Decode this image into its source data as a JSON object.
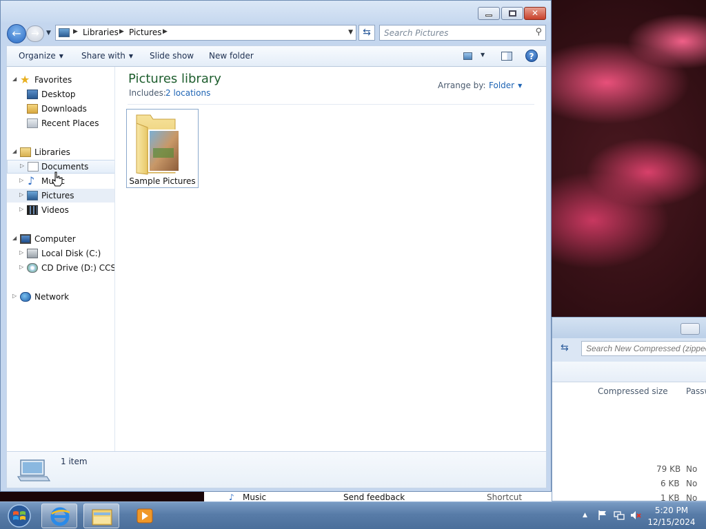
{
  "window": {
    "breadcrumbs": [
      "Libraries",
      "Pictures"
    ],
    "search_placeholder": "Search Pictures"
  },
  "toolbar": {
    "organize": "Organize",
    "share_with": "Share with",
    "slide_show": "Slide show",
    "new_folder": "New folder",
    "help": "?"
  },
  "nav": {
    "favorites": "Favorites",
    "desktop": "Desktop",
    "downloads": "Downloads",
    "recent_places": "Recent Places",
    "libraries": "Libraries",
    "documents": "Documents",
    "music": "Music",
    "pictures": "Pictures",
    "videos": "Videos",
    "computer": "Computer",
    "local_disk": "Local Disk (C:)",
    "cd_drive": "CD Drive (D:) CCSA_",
    "network": "Network"
  },
  "content": {
    "title": "Pictures library",
    "includes_label": "Includes:",
    "includes_link": "2 locations",
    "arrange_label": "Arrange by:",
    "arrange_value": "Folder",
    "items": [
      {
        "label": "Sample Pictures"
      }
    ]
  },
  "details": {
    "item_count": "1 item"
  },
  "back_window": {
    "search_placeholder": "Search New Compressed (zipped)",
    "col_compressed_size": "Compressed size",
    "col_password": "Passw",
    "rows": [
      {
        "size": "79 KB",
        "password": "No"
      },
      {
        "size": "6 KB",
        "password": "No"
      },
      {
        "size": "1 KB",
        "password": "No"
      }
    ]
  },
  "third_window": {
    "music": "Music",
    "send_feedback": "Send feedback",
    "shortcut": "Shortcut"
  },
  "taskbar": {
    "time": "5:20 PM",
    "date": "12/15/2024"
  },
  "colors": {
    "library_title": "#1e5e2e",
    "link": "#1e64b4"
  }
}
